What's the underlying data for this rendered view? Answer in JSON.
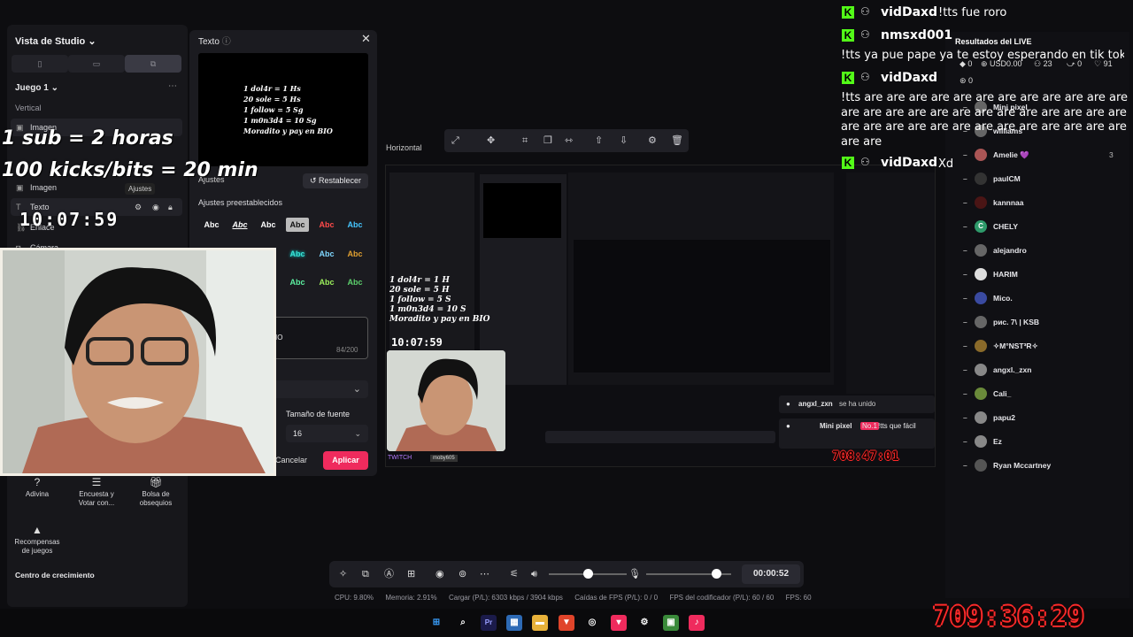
{
  "left_panel": {
    "title": "Vista de Studio",
    "scene": "Juego 1",
    "section_vertical": "Vertical",
    "sources": [
      {
        "label": "Imagen"
      },
      {
        "label": "Imagen"
      },
      {
        "label": "Texto"
      },
      {
        "label": "Enlace"
      },
      {
        "label": "Cámara"
      }
    ],
    "tooltip": "Ajustes",
    "tools": [
      {
        "label": "Adivina"
      },
      {
        "label": "Encuesta y Votar con..."
      },
      {
        "label": "Bolsa de obsequios"
      },
      {
        "label": "Recompensas de juegos"
      }
    ],
    "growth_center": "Centro de crecimiento"
  },
  "modal": {
    "title": "Texto",
    "preview_lines": [
      "1 dol4r = 1 Hs",
      "20 sole = 5 Hs",
      "1 follow = 5 Sg",
      "1 m0n3d4 = 10 Sg",
      "Moradito y pay en BIO"
    ],
    "partial_label": "Ajustes",
    "reset_label": "Restablecer",
    "presets_label": "Ajustes preestablecidos",
    "preset_sample": "Abc",
    "input_value": "IO",
    "char_count": "84/200",
    "font_size_label": "Tamaño de fuente",
    "font_size_value": "16",
    "cancel_label": "Cancelar",
    "apply_label": "Aplicar"
  },
  "overlays": {
    "sub_line": "1 sub = 2 horas",
    "kicks_line": "100 kicks/bits = 20 min",
    "clock": "10:07:59",
    "mini_lines": [
      "1 dol4r = 1 H",
      "20 sole = 5 H",
      "1 follow = 5 S",
      "1 m0n3d4 = 10 S",
      "Moradito y pay en BIO"
    ],
    "mini_clock": "10:07:59",
    "canvas_clock": "708:47:01",
    "big_clock": "709:36:29"
  },
  "horizontal": {
    "label": "Horizontal",
    "twitch_tag": "TWITCH",
    "moby_tag": "moby605",
    "join_user": "angxl_zxn",
    "join_text": "se ha unido",
    "msg_user": "Mini pixel",
    "msg_badge": "No.1",
    "msg_text": "!tts que fácil"
  },
  "chat": [
    {
      "user": "vidDaxd",
      "text": "!tts fue roro"
    },
    {
      "user": "nmsxd001",
      "text": "!tts ya pue pape ya te estoy esperando en tik tok"
    },
    {
      "user": "vidDaxd",
      "text": "!tts are are are are are are are are are are are are are are are are are are are are are are are are are are are are are are are are are are are are are are are are"
    },
    {
      "user": "vidDaxd",
      "text": "Xd"
    }
  ],
  "results": {
    "title": "Resultados del LIVE",
    "stats": [
      "0",
      "USD0.00",
      "23",
      "0",
      "91",
      "0"
    ],
    "viewers": [
      {
        "name": "Mini pixel",
        "count": ""
      },
      {
        "name": "williams",
        "count": ""
      },
      {
        "name": "Amelie 💜",
        "count": "3"
      },
      {
        "name": "paulCM",
        "count": ""
      },
      {
        "name": "kannnaa",
        "count": ""
      },
      {
        "name": "CHELY",
        "count": ""
      },
      {
        "name": "alejandro",
        "count": ""
      },
      {
        "name": "HARIM",
        "count": ""
      },
      {
        "name": "Mico.",
        "count": ""
      },
      {
        "name": "рис. 7\\ | KSB",
        "count": ""
      },
      {
        "name": "✧M°NST³R✧",
        "count": ""
      },
      {
        "name": "angxl._zxn",
        "count": ""
      },
      {
        "name": "Cali_",
        "count": ""
      },
      {
        "name": "papu2",
        "count": ""
      },
      {
        "name": "Ez",
        "count": ""
      },
      {
        "name": "Ryan Mccartney",
        "count": ""
      }
    ]
  },
  "controls": {
    "timer": "00:00:52",
    "volume_level": 0.5,
    "mic_level": 0.82
  },
  "status": {
    "cpu": "CPU: 9.80%",
    "memory": "Memoria: 2.91%",
    "upload": "Cargar (P/L): 6303 kbps / 3904 kbps",
    "drops": "Caídas de FPS (P/L): 0 / 0",
    "encoder_fps": "FPS del codificador (P/L): 60 / 60",
    "fps": "FPS: 60"
  },
  "colors": {
    "accent": "#ef2b5d",
    "kick_green": "#53fc18",
    "clock_red": "#ff2a2a"
  }
}
